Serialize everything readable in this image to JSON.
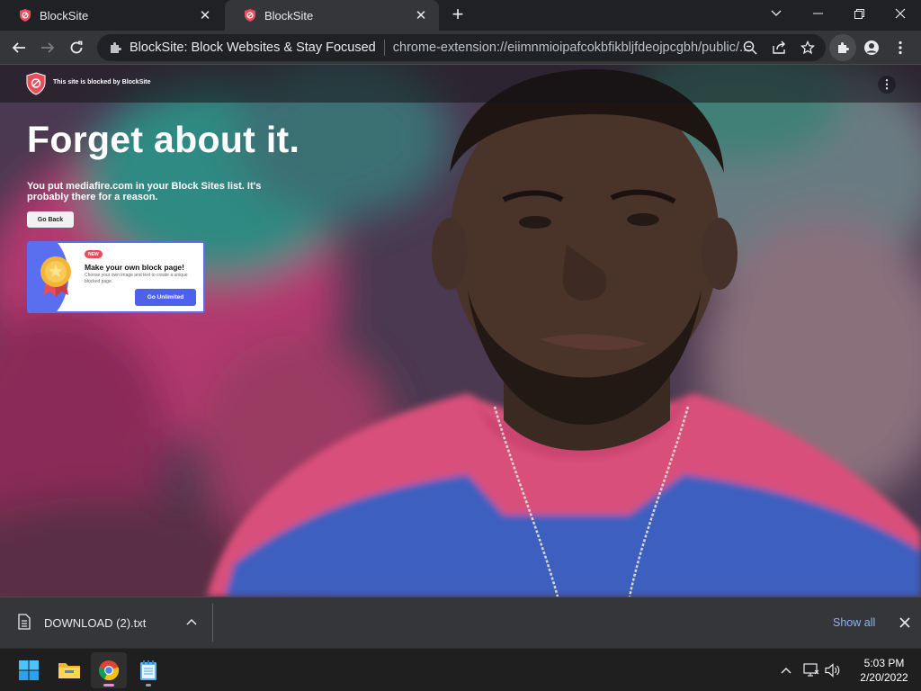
{
  "browser": {
    "tabs": [
      {
        "title": "BlockSite",
        "active": false
      },
      {
        "title": "BlockSite",
        "active": true
      }
    ],
    "new_tab_symbol": "+",
    "omnibox": {
      "extension_name": "BlockSite: Block Websites & Stay Focused",
      "url": "chrome-extension://eiimnmioipafcokbfikbljfdeojpcgbh/public/..."
    },
    "icons": {
      "back": "arrow-left-icon",
      "forward": "arrow-right-icon",
      "reload": "reload-icon",
      "zoom": "zoom-icon",
      "share": "share-icon",
      "bookmark": "star-icon",
      "extensions": "puzzle-icon",
      "profile": "person-icon",
      "menu": "kebab-menu-icon"
    }
  },
  "page": {
    "blocked_tag": "This site is blocked by BlockSite",
    "headline": "Forget about it.",
    "subtext": "You put mediafire.com in your Block Sites list. It's probably there for a reason.",
    "go_back_label": "Go Back",
    "promo": {
      "badge": "NEW",
      "title": "Make your own block page!",
      "description": "Choose your own image and text to create a unique blocked page.",
      "button_label": "Go Unlimited"
    }
  },
  "downloads": {
    "file_name": "DOWNLOAD (2).txt",
    "show_all_label": "Show all"
  },
  "taskbar": {
    "time": "5:03 PM",
    "date": "2/20/2022"
  },
  "colors": {
    "chrome_dark": "#202124",
    "toolbar": "#35363a",
    "link_blue": "#8ab4f8",
    "promo_blue": "#4d62e8",
    "blocksite_red": "#e84d5a"
  }
}
